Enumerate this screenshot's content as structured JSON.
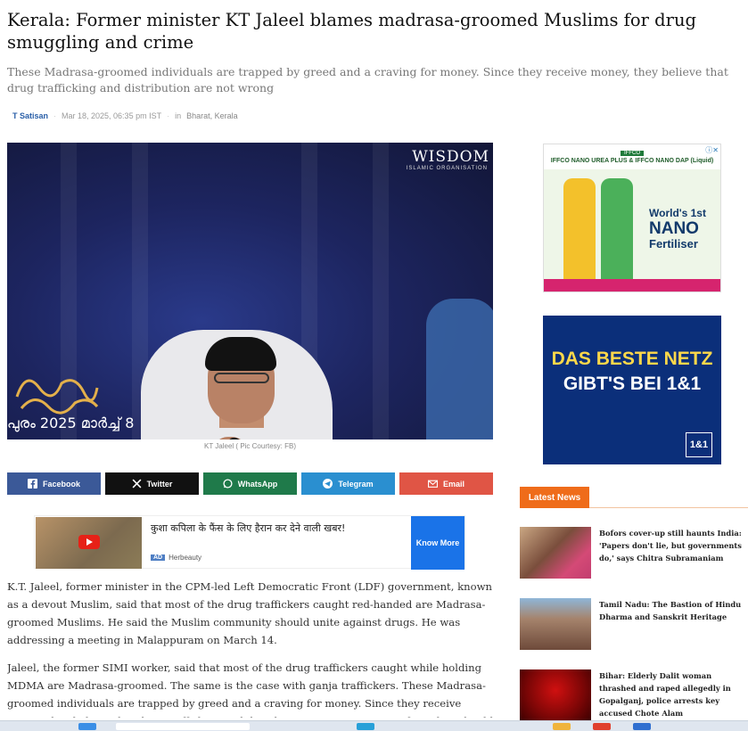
{
  "article": {
    "headline": "Kerala: Former minister KT Jaleel blames madrasa-groomed Muslims for drug smuggling and crime",
    "subhead": "These Madrasa-groomed individuals are trapped by greed and a craving for money. Since they receive money, they believe that drug trafficking and distribution are not wrong",
    "author": "T Satisan",
    "date": "Mar 18, 2025, 06:35 pm IST",
    "in_label": "in",
    "categories": "Bharat, Kerala",
    "image_caption": "KT Jaleel ( Pic Courtesy: FB)",
    "image_logo": "WISDOM",
    "image_logo_sub": "ISLAMIC ORGANISATION",
    "image_event_date": "പുരം 2025 മാർച്ച് 8",
    "paragraphs": [
      "K.T. Jaleel, former minister in the CPM-led Left Democratic Front (LDF) government, known as a devout Muslim, said that most of the drug traffickers caught red-handed are Madrasa-groomed Muslims. He said the Muslim community should unite against drugs. He was addressing a meeting in Malappuram on March 14.",
      "Jaleel, the former SIMI worker, said that most of the drug traffickers caught while holding MDMA are Madrasa-groomed. The same is the case with ganja traffickers. These Madrasa-groomed individuals are trapped by greed and a craving for money. Since they receive money, they believe that drug trafficking and distribution are not wrong. In fact, they should serve as role models for"
    ]
  },
  "share": [
    {
      "label": "Facebook",
      "icon": "facebook-icon",
      "color": "#3b5998"
    },
    {
      "label": "Twitter",
      "icon": "x-icon",
      "color": "#111111"
    },
    {
      "label": "WhatsApp",
      "icon": "whatsapp-icon",
      "color": "#1f7a4a"
    },
    {
      "label": "Telegram",
      "icon": "telegram-icon",
      "color": "#2a8fd0"
    },
    {
      "label": "Email",
      "icon": "email-icon",
      "color": "#e05545"
    }
  ],
  "inline_ad": {
    "title": "कुशा कपिला के फैंस के लिए हैरान कर देने वाली खबर!",
    "badge": "AD",
    "source": "Herbeauty",
    "cta": "Know More"
  },
  "side_ad_1": {
    "brand": "IFFCO",
    "product": "IFFCO NANO UREA PLUS & IFFCO NANO DAP (Liquid)",
    "line1": "World's 1st",
    "line2": "NANO",
    "line3": "Fertiliser"
  },
  "side_ad_2": {
    "line1": "DAS BESTE NETZ",
    "line2": "GIBT'S BEI 1&1",
    "logo": "1&1"
  },
  "latest": {
    "header": "Latest News",
    "items": [
      {
        "title": "Bofors cover-up still haunts India: 'Papers don't lie, but governments do,' says Chitra Subramaniam"
      },
      {
        "title": "Tamil Nadu: The Bastion of Hindu Dharma and Sanskrit Heritage"
      },
      {
        "title": "Bihar: Elderly Dalit woman thrashed and raped allegedly in Gopalganj, police arrests key accused Chote Alam"
      }
    ]
  }
}
